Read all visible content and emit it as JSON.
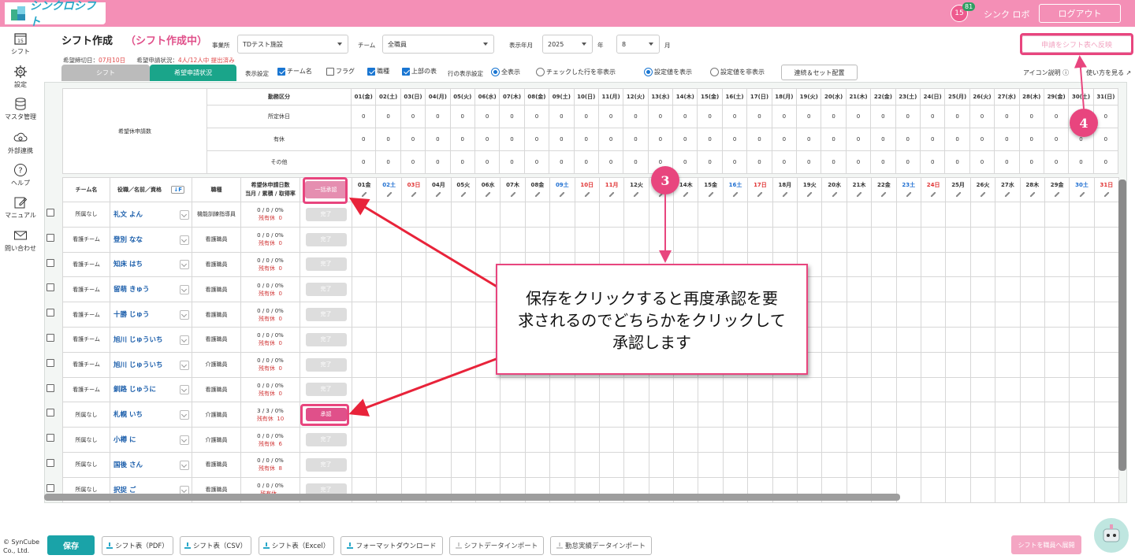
{
  "header": {
    "logo_text": "シンクロシフト",
    "calendar_day": "15",
    "notification_count": "81",
    "user_name": "シンク ロボ",
    "logout_label": "ログアウト"
  },
  "sidebar": {
    "items": [
      {
        "label": "シフト",
        "icon": "calendar-icon"
      },
      {
        "label": "設定",
        "icon": "gear-icon"
      },
      {
        "label": "マスタ管理",
        "icon": "database-icon"
      },
      {
        "label": "外部連携",
        "icon": "cloud-sync-icon"
      },
      {
        "label": "ヘルプ",
        "icon": "help-icon"
      },
      {
        "label": "マニュアル",
        "icon": "edit-icon"
      },
      {
        "label": "問い合わせ",
        "icon": "mail-icon"
      }
    ],
    "copyright": [
      "© SynCube",
      "Co., Ltd."
    ]
  },
  "page": {
    "title": "シフト作成",
    "status": "（シフト作成中）",
    "deadline_label": "希望締切日：",
    "deadline_value": "07月10日",
    "submit_label": "希望申請状況：",
    "submit_value": "4人/12人中 提出済み"
  },
  "filters": {
    "office_label": "事業所",
    "office_value": "TDテスト施設",
    "team_label": "チーム",
    "team_value": "全職員",
    "period_label": "表示年月",
    "year_value": "2025",
    "year_unit": "年",
    "month_value": "8",
    "month_unit": "月"
  },
  "reflect_button": "申請をシフト表へ反映",
  "tabs": {
    "shift": "シフト",
    "request": "希望申請状況"
  },
  "display_settings": {
    "label": "表示設定",
    "checks": [
      {
        "label": "チーム名",
        "on": true
      },
      {
        "label": "フラグ",
        "on": false
      },
      {
        "label": "職種",
        "on": true
      },
      {
        "label": "上部の表",
        "on": true
      }
    ],
    "row_label": "行の表示設定",
    "row_options": [
      {
        "label": "全表示",
        "on": true
      },
      {
        "label": "チェックした行を非表示",
        "on": false
      }
    ],
    "value_options": [
      {
        "label": "設定値を表示",
        "on": true
      },
      {
        "label": "設定値を非表示",
        "on": false
      }
    ],
    "set_button": "連続＆セット配置",
    "icon_help": "アイコン説明",
    "how_to": "使い方を見る"
  },
  "summary": {
    "group_label": "希望休申請数",
    "header_label": "勤務区分",
    "rows": [
      {
        "label": "所定休日",
        "values": [
          0,
          0,
          0,
          0,
          0,
          0,
          0,
          0,
          0,
          0,
          0,
          0,
          0,
          0,
          0,
          0,
          0,
          0,
          0,
          0,
          0,
          0,
          0,
          0,
          0,
          0,
          0,
          0,
          0,
          0,
          0
        ]
      },
      {
        "label": "有休",
        "values": [
          0,
          0,
          0,
          0,
          0,
          0,
          0,
          0,
          0,
          0,
          0,
          0,
          0,
          0,
          0,
          0,
          0,
          0,
          0,
          0,
          0,
          0,
          0,
          0,
          0,
          0,
          0,
          0,
          0,
          0,
          0
        ]
      },
      {
        "label": "その他",
        "values": [
          0,
          0,
          0,
          0,
          0,
          0,
          0,
          0,
          0,
          0,
          0,
          0,
          0,
          0,
          0,
          0,
          0,
          0,
          0,
          0,
          0,
          0,
          0,
          0,
          0,
          0,
          0,
          0,
          0,
          0,
          0
        ]
      }
    ],
    "days": [
      "01(金)",
      "02(土)",
      "03(日)",
      "04(月)",
      "05(火)",
      "06(水)",
      "07(木)",
      "08(金)",
      "09(土)",
      "10(日)",
      "11(月)",
      "12(火)",
      "13(水)",
      "14(木)",
      "15(金)",
      "16(土)",
      "17(日)",
      "18(月)",
      "19(火)",
      "20(水)",
      "21(木)",
      "22(金)",
      "23(土)",
      "24(日)",
      "25(月)",
      "26(火)",
      "27(水)",
      "28(木)",
      "29(金)",
      "30(土)",
      "31(日)"
    ],
    "day_types": [
      "w",
      "sat",
      "sun",
      "w",
      "w",
      "w",
      "w",
      "w",
      "sat",
      "sun",
      "sun",
      "w",
      "w",
      "w",
      "w",
      "sat",
      "sun",
      "w",
      "w",
      "w",
      "w",
      "w",
      "sat",
      "sun",
      "w",
      "w",
      "w",
      "w",
      "w",
      "sat",
      "sun"
    ]
  },
  "main_table": {
    "headers": {
      "team": "チーム名",
      "name": "役職／名前／資格",
      "sort_icon": "sort-icon",
      "job": "職種",
      "stats_line1": "希望休申請日数",
      "stats_line2": "当月 / 累積 / 取得率",
      "bulk_approve": "一括承認"
    },
    "days": [
      "01金",
      "02土",
      "03日",
      "04月",
      "05火",
      "06水",
      "07木",
      "08金",
      "09土",
      "10日",
      "11月",
      "12火",
      "13水",
      "14木",
      "15金",
      "16土",
      "17日",
      "18月",
      "19火",
      "20水",
      "21木",
      "22金",
      "23土",
      "24日",
      "25月",
      "26火",
      "27水",
      "28木",
      "29金",
      "30土",
      "31日"
    ],
    "remaining_prefix": "残有休",
    "rows": [
      {
        "team": "所属なし",
        "name": "礼文 よん",
        "job": "機能訓練指導員",
        "stats": "0 / 0 / 0%",
        "remaining": "0",
        "action": "完了",
        "approve": false
      },
      {
        "team": "看護チーム",
        "name": "登別 なな",
        "job": "看護職員",
        "stats": "0 / 0 / 0%",
        "remaining": "0",
        "action": "完了",
        "approve": false
      },
      {
        "team": "看護チーム",
        "name": "知床 はち",
        "job": "看護職員",
        "stats": "0 / 0 / 0%",
        "remaining": "0",
        "action": "完了",
        "approve": false
      },
      {
        "team": "看護チーム",
        "name": "留萌 きゅう",
        "job": "看護職員",
        "stats": "0 / 0 / 0%",
        "remaining": "0",
        "action": "完了",
        "approve": false
      },
      {
        "team": "看護チーム",
        "name": "十勝 じゅう",
        "job": "看護職員",
        "stats": "0 / 0 / 0%",
        "remaining": "0",
        "action": "完了",
        "approve": false
      },
      {
        "team": "看護チーム",
        "name": "旭川 じゅういち",
        "job": "看護職員",
        "stats": "0 / 0 / 0%",
        "remaining": "0",
        "action": "完了",
        "approve": false
      },
      {
        "team": "看護チーム",
        "name": "旭川 じゅういち",
        "job": "介護職員",
        "stats": "0 / 0 / 0%",
        "remaining": "0",
        "action": "完了",
        "approve": false
      },
      {
        "team": "看護チーム",
        "name": "釧路 じゅうに",
        "job": "看護職員",
        "stats": "0 / 0 / 0%",
        "remaining": "0",
        "action": "完了",
        "approve": false
      },
      {
        "team": "所属なし",
        "name": "札幌 いち",
        "job": "介護職員",
        "stats": "3 / 3 / 0%",
        "remaining": "10",
        "action": "承認",
        "approve": true
      },
      {
        "team": "所属なし",
        "name": "小樽 に",
        "job": "介護職員",
        "stats": "0 / 0 / 0%",
        "remaining": "6",
        "action": "完了",
        "approve": false
      },
      {
        "team": "所属なし",
        "name": "国後 さん",
        "job": "看護職員",
        "stats": "0 / 0 / 0%",
        "remaining": "8",
        "action": "完了",
        "approve": false
      },
      {
        "team": "所属なし",
        "name": "択捉 ご",
        "job": "看護職員",
        "stats": "0 / 0 / 0%",
        "remaining": "",
        "action": "完了",
        "approve": false
      }
    ]
  },
  "footer": {
    "save": "保存",
    "buttons": [
      "シフト表（PDF）",
      "シフト表（CSV）",
      "シフト表（Excel）",
      "フォーマットダウンロード",
      "シフトデータインポート",
      "勤怠実績データインポート"
    ],
    "deploy": "シフトを職員へ展開"
  },
  "annotation": {
    "note_lines": [
      "保存をクリックすると再度承認を要",
      "求されるのでどちらかをクリックして",
      "承認します"
    ],
    "badge_3": "3",
    "badge_4": "4",
    "accent": "#e8457e"
  }
}
